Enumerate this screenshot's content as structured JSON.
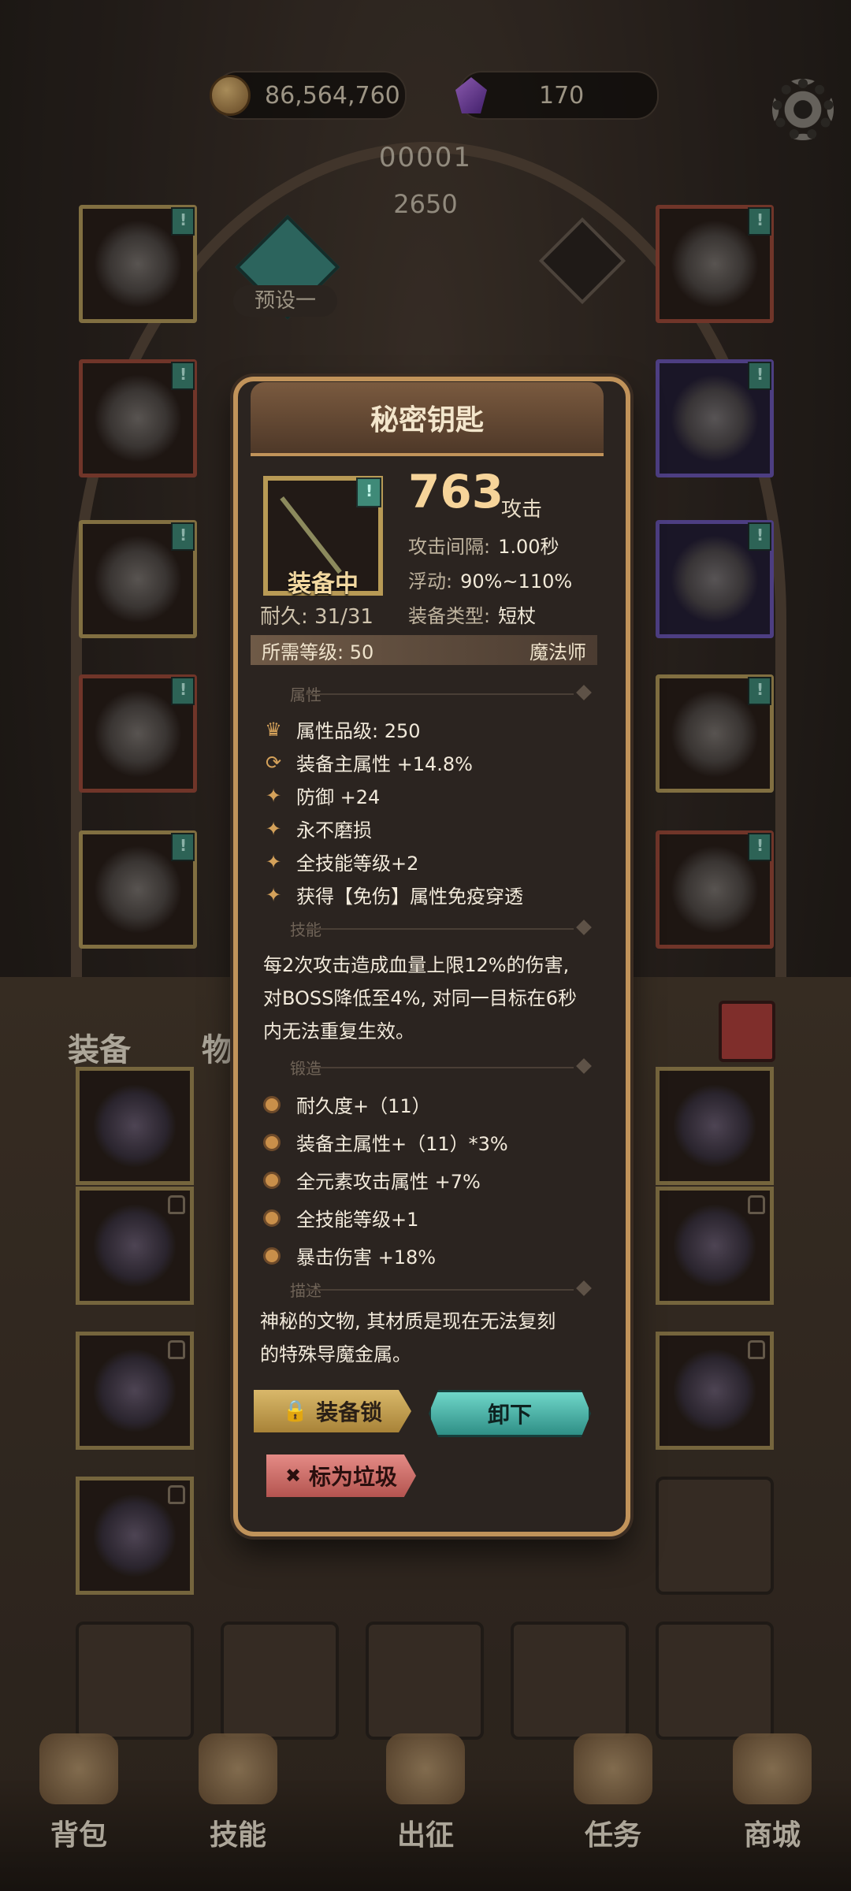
{
  "resources": {
    "gold": "86,564,760",
    "gems": "170"
  },
  "character": {
    "id": "00001",
    "power": "2650",
    "preset_label": "预设一"
  },
  "tabs": {
    "equipment": "装备",
    "items": "物"
  },
  "nav": {
    "bag": "背包",
    "skills": "技能",
    "expedition": "出征",
    "tasks": "任务",
    "shop": "商城"
  },
  "popup": {
    "title": "秘密钥匙",
    "equipped_label": "装备中",
    "durability": "耐久: 31/31",
    "attack_value": "763",
    "attack_unit": "攻击",
    "stats": {
      "interval_label": "攻击间隔:",
      "interval_value": "1.00秒",
      "float_label": "浮动:",
      "float_value": "90%~110%",
      "type_label": "装备类型:",
      "type_value": "短杖"
    },
    "requirement": {
      "level": "所需等级: 50",
      "class": "魔法师"
    },
    "section_attributes": "属性",
    "attributes": [
      "属性品级: 250",
      "装备主属性 +14.8%",
      "防御 +24",
      "永不磨损",
      "全技能等级+2",
      "获得【免伤】属性免疫穿透"
    ],
    "section_skill": "技能",
    "skill_text_1": "每2次攻击造成血量上限12%的伤害,",
    "skill_text_2": "对BOSS降低至4%, 对同一目标在6秒",
    "skill_text_3": "内无法重复生效。",
    "section_forge": "锻造",
    "forge": [
      "耐久度+（11）",
      "装备主属性+（11）*3%",
      "全元素攻击属性 +7%",
      "全技能等级+1",
      "暴击伤害 +18%"
    ],
    "section_desc": "描述",
    "desc_1": "神秘的文物, 其材质是现在无法复刻",
    "desc_2": "的特殊导魔金属。",
    "buttons": {
      "lock": "装备锁",
      "unload": "卸下",
      "junk": "标为垃圾"
    }
  }
}
